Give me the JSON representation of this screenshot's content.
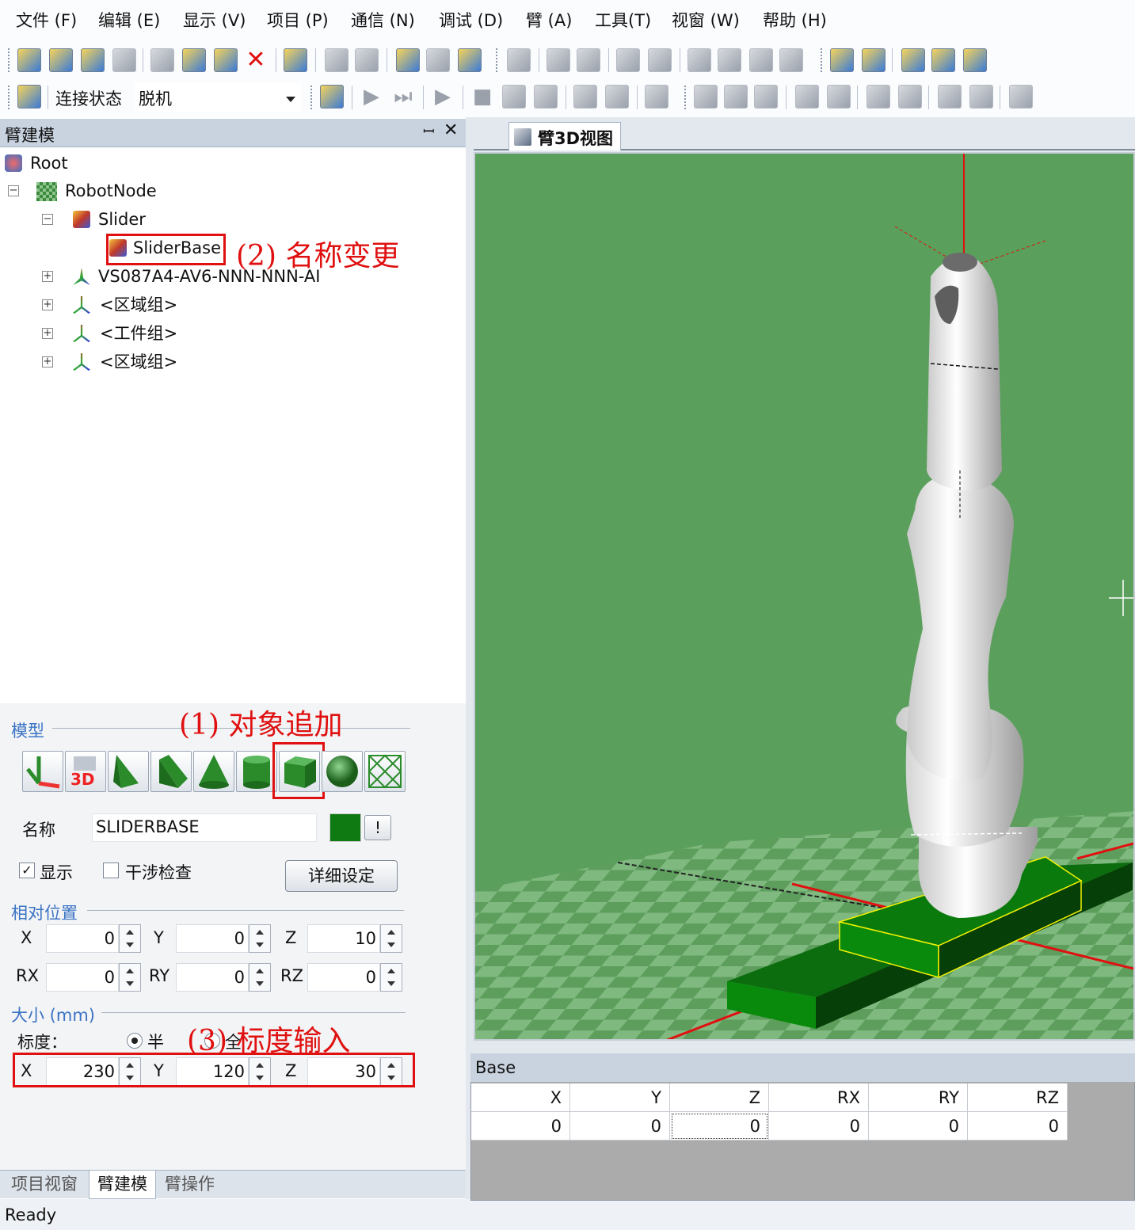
{
  "menu": [
    "文件 (F)",
    "编辑 (E)",
    "显示 (V)",
    "项目 (P)",
    "通信 (N)",
    "调试 (D)",
    "臂 (A)",
    "工具(T)",
    "视窗 (W)",
    "帮助 (H)"
  ],
  "toolbar3": {
    "connection_label": "连接状态",
    "connection_value": "脱机"
  },
  "left_panel": {
    "title": "臂建模",
    "tree": {
      "root": "Root",
      "robot_node": "RobotNode",
      "slider": "Slider",
      "slider_base": "SliderBase",
      "robot": "VS087A4-AV6-NNN-NNN-AI",
      "group1": "<区域组>",
      "group2": "<工件组>",
      "group3": "<区域组>"
    },
    "model_group_label": "模型",
    "name_label": "名称",
    "name_value": "SLIDERBASE",
    "color_button": "!",
    "display_label": "显示",
    "display_checked": true,
    "interference_label": "干涉检查",
    "interference_checked": false,
    "detail_button": "详细设定",
    "relative_position_label": "相对位置",
    "position": {
      "x_label": "X",
      "x": "0",
      "y_label": "Y",
      "y": "0",
      "z_label": "Z",
      "z": "10",
      "rx_label": "RX",
      "rx": "0",
      "ry_label": "RY",
      "ry": "0",
      "rz_label": "RZ",
      "rz": "0"
    },
    "size_label": "大小 (mm)",
    "scale_label": "标度：",
    "scale_half": "半",
    "scale_full": "全",
    "size": {
      "x_label": "X",
      "x": "230",
      "y_label": "Y",
      "y": "120",
      "z_label": "Z",
      "z": "30"
    }
  },
  "annotations": {
    "a1": "(1) 对象追加",
    "a2": "(2) 名称变更",
    "a3": "(3) 标度输入"
  },
  "bottom_tabs": [
    "项目视窗",
    "臂建模",
    "臂操作"
  ],
  "status": "Ready",
  "view_tab": "臂3D视图",
  "base_panel": {
    "title": "Base",
    "headers": [
      "X",
      "Y",
      "Z",
      "RX",
      "RY",
      "RZ"
    ],
    "values": [
      "0",
      "0",
      "0",
      "0",
      "0",
      "0"
    ]
  },
  "colors": {
    "viewport_bg": "#5b9f5c",
    "annotation": "#e01010",
    "group_label": "#3b73c4",
    "object_color": "#0f7a12"
  }
}
